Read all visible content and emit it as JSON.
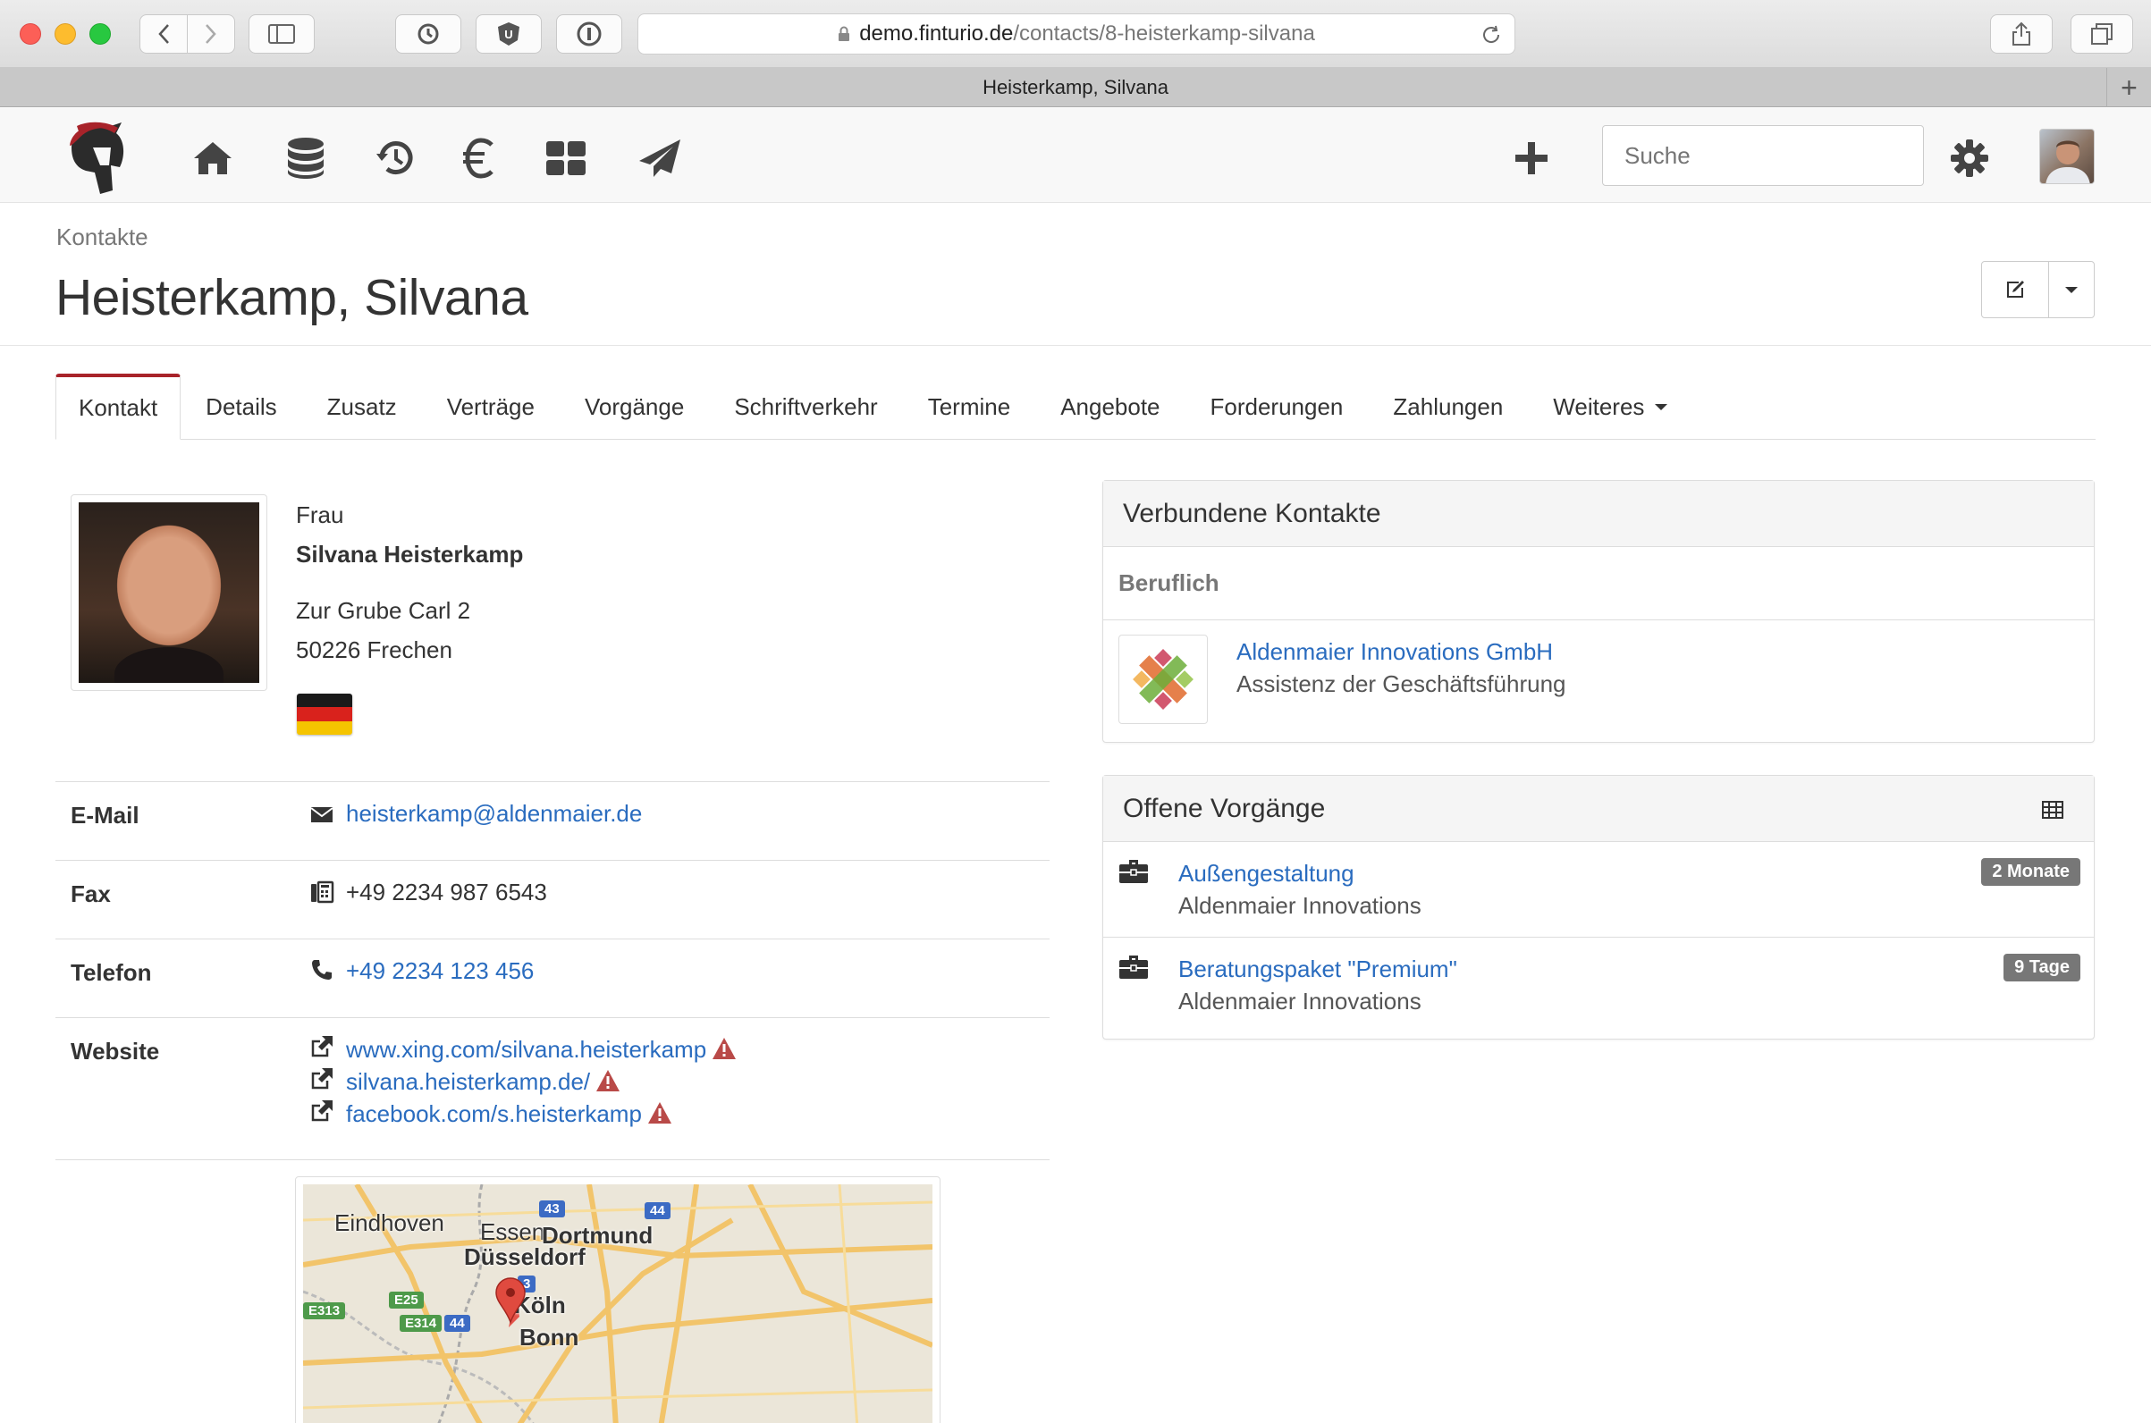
{
  "browser": {
    "url_host": "demo.finturio.de",
    "url_path": "/contacts/8-heisterkamp-silvana",
    "tab_title": "Heisterkamp, Silvana"
  },
  "navbar": {
    "search_placeholder": "Suche"
  },
  "header": {
    "breadcrumb": "Kontakte",
    "title": "Heisterkamp, Silvana"
  },
  "tabs": [
    "Kontakt",
    "Details",
    "Zusatz",
    "Verträge",
    "Vorgänge",
    "Schriftverkehr",
    "Termine",
    "Angebote",
    "Forderungen",
    "Zahlungen",
    "Weiteres"
  ],
  "contact": {
    "salutation": "Frau",
    "name": "Silvana Heisterkamp",
    "street": "Zur Grube Carl 2",
    "city": "50226 Frechen",
    "country_flag": "de",
    "email_label": "E-Mail",
    "email": "heisterkamp@aldenmaier.de",
    "fax_label": "Fax",
    "fax": "+49 2234 987 6543",
    "phone_label": "Telefon",
    "phone": "+49 2234 123 456",
    "website_label": "Website",
    "websites": [
      "www.xing.com/silvana.heisterkamp",
      "silvana.heisterkamp.de/",
      "facebook.com/s.heisterkamp"
    ]
  },
  "map": {
    "labels": [
      "Eindhoven",
      "Essen",
      "Dortmund",
      "Düsseldorf",
      "Köln",
      "Bonn"
    ],
    "shields": [
      "43",
      "44",
      "3",
      "E25",
      "E313",
      "E314",
      "44"
    ]
  },
  "connected": {
    "title": "Verbundene Kontakte",
    "group": "Beruflich",
    "company_name": "Aldenmaier Innovations GmbH",
    "company_role": "Assistenz der Geschäftsführung"
  },
  "open_processes": {
    "title": "Offene Vorgänge",
    "items": [
      {
        "title": "Außengestaltung",
        "company": "Aldenmaier Innovations",
        "badge": "2 Monate"
      },
      {
        "title": "Beratungspaket \"Premium\"",
        "company": "Aldenmaier Innovations",
        "badge": "9 Tage"
      }
    ]
  },
  "colors": {
    "accent": "#a8232a",
    "link": "#2a6cbf",
    "warning": "#b94a48",
    "badge": "#777777"
  }
}
